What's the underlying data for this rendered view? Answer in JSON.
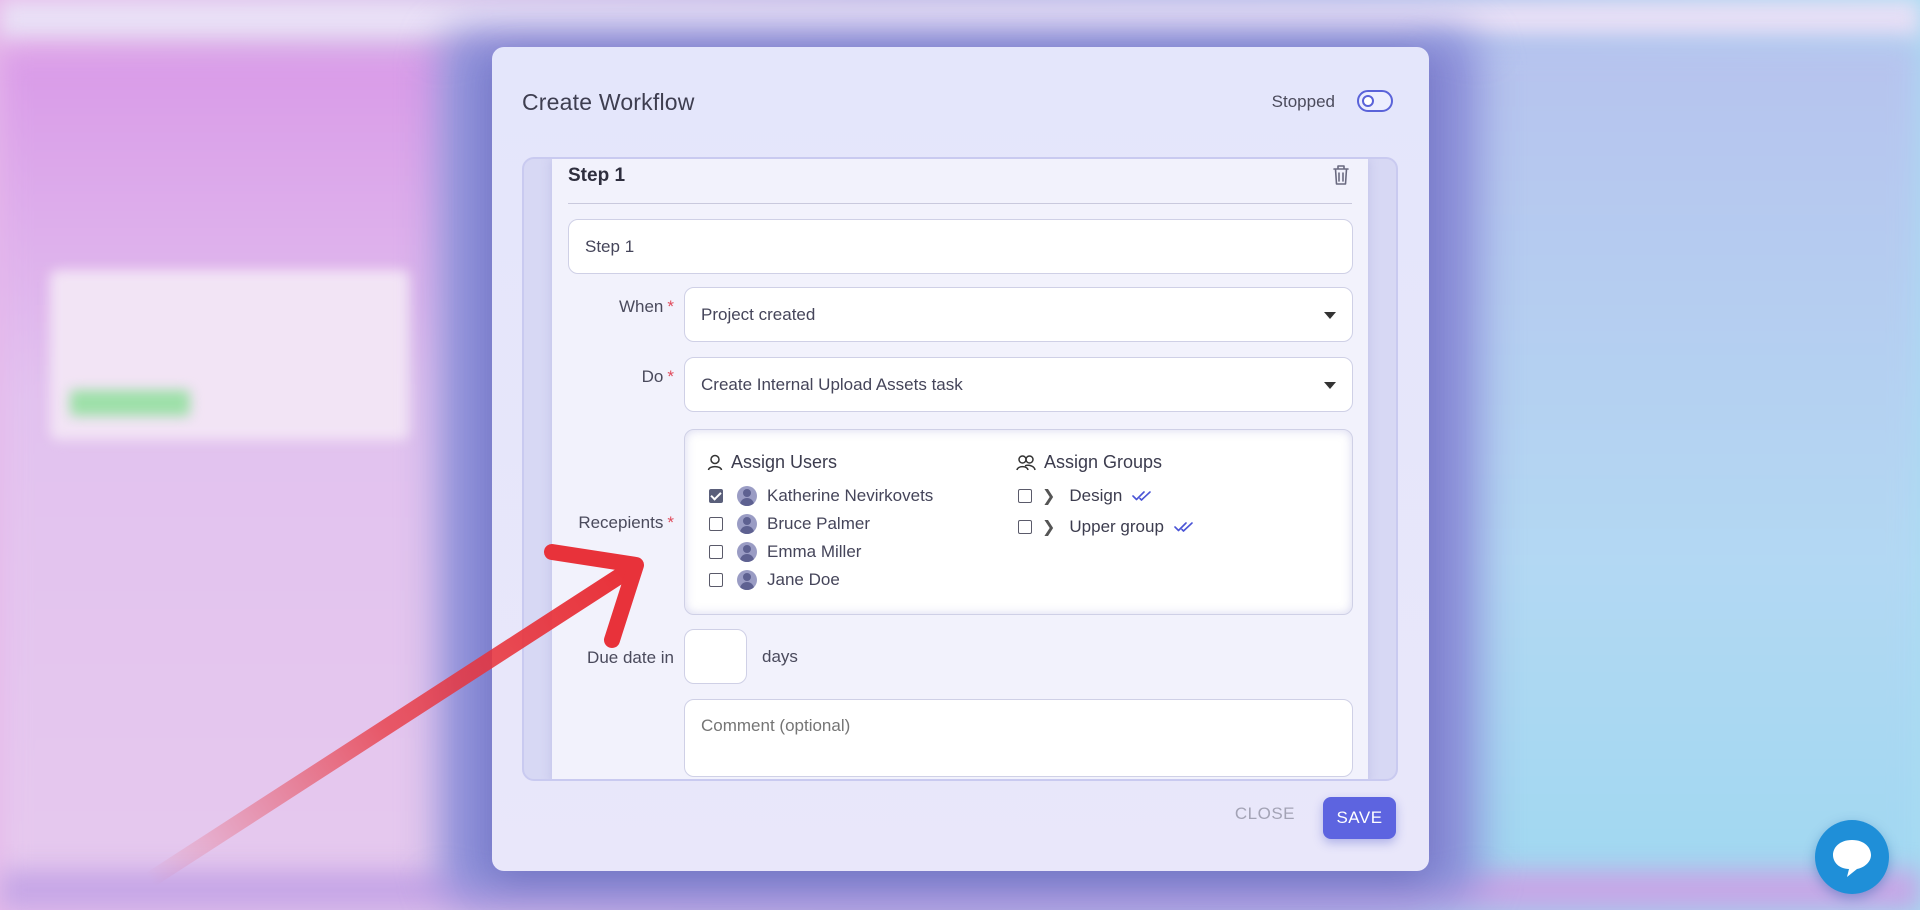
{
  "modal": {
    "title": "Create Workflow",
    "status_label": "Stopped",
    "toggle_state": "off"
  },
  "step": {
    "heading": "Step 1",
    "name_value": "Step 1",
    "when_label": "When",
    "when_value": "Project created",
    "do_label": "Do",
    "do_value": "Create Internal Upload Assets task",
    "recipients_label": "Recepients",
    "required_mark": "*",
    "assign_users": {
      "heading": "Assign Users",
      "users": [
        {
          "name": "Katherine Nevirkovets",
          "checked": true
        },
        {
          "name": "Bruce Palmer",
          "checked": false
        },
        {
          "name": "Emma Miller",
          "checked": false
        },
        {
          "name": "Jane Doe",
          "checked": false
        }
      ]
    },
    "assign_groups": {
      "heading": "Assign Groups",
      "groups": [
        {
          "name": "Design",
          "checked": false
        },
        {
          "name": "Upper group",
          "checked": false
        }
      ]
    },
    "due_label": "Due date in",
    "due_value": "",
    "due_unit": "days",
    "comment_placeholder": "Comment (optional)"
  },
  "footer": {
    "close_label": "CLOSE",
    "save_label": "SAVE"
  },
  "colors": {
    "accent": "#5d64e0",
    "required": "#e04a5a",
    "annotation_arrow": "#e8323a",
    "chat_bubble": "#1f8fd8"
  }
}
